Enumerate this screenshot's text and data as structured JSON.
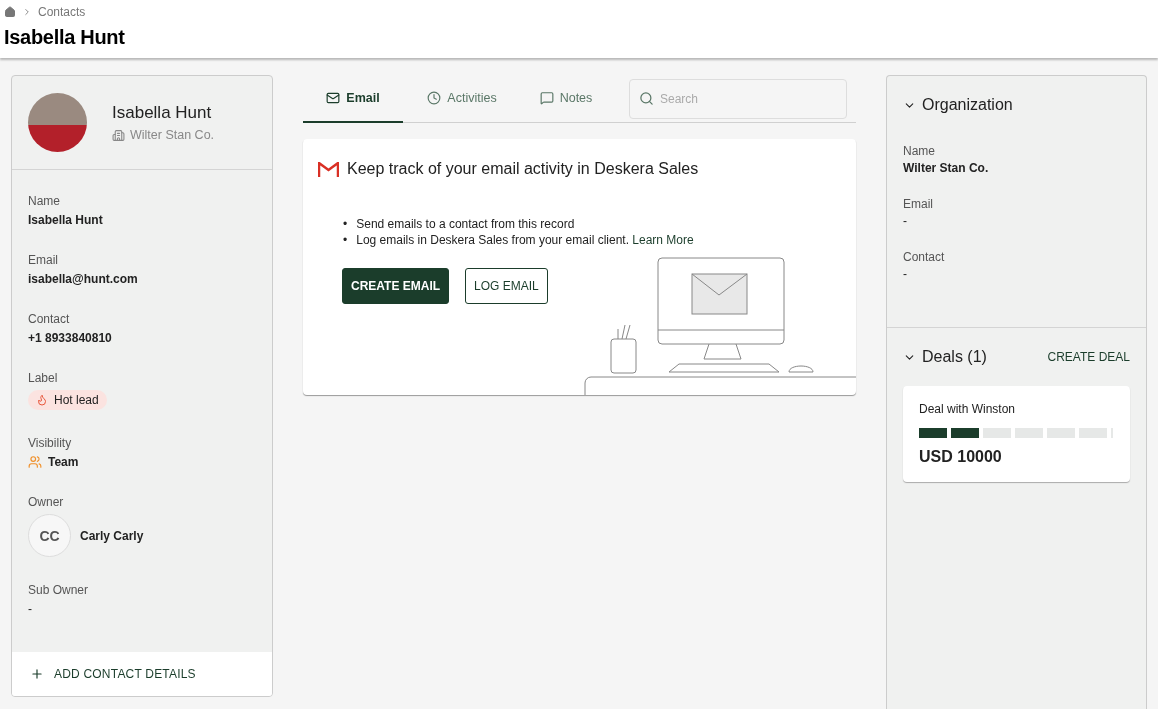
{
  "breadcrumb": {
    "items": [
      "Contacts"
    ]
  },
  "page_title": "Isabella Hunt",
  "profile": {
    "name": "Isabella Hunt",
    "company": "Wilter Stan Co.",
    "fields": [
      {
        "kind": "text",
        "label": "Name",
        "value": "Isabella Hunt"
      },
      {
        "kind": "text",
        "label": "Email",
        "value": "isabella@hunt.com"
      },
      {
        "kind": "text",
        "label": "Contact",
        "value": "+1 8933840810"
      },
      {
        "kind": "tag",
        "label": "Label",
        "value": "Hot lead"
      },
      {
        "kind": "team",
        "label": "Visibility",
        "value": "Team"
      },
      {
        "kind": "owner",
        "label": "Owner",
        "initials": "CC",
        "value": "Carly Carly"
      },
      {
        "kind": "plain",
        "label": "Sub Owner",
        "value": "-"
      }
    ],
    "add_button": "ADD CONTACT DETAILS"
  },
  "tabs": [
    {
      "label": "Email",
      "selected": true
    },
    {
      "label": "Activities",
      "selected": false
    },
    {
      "label": "Notes",
      "selected": false
    }
  ],
  "search": {
    "placeholder": "Search"
  },
  "email_panel": {
    "title": "Keep track of your email activity in Deskera Sales",
    "bullets": [
      {
        "marker": "•",
        "text": "Send emails to a contact from this record"
      },
      {
        "marker": "•",
        "text": "Log emails in Deskera Sales from your email client.",
        "link": "Learn More"
      }
    ],
    "buttons": [
      {
        "label": "CREATE EMAIL",
        "kind": "primary"
      },
      {
        "label": "LOG EMAIL",
        "kind": "outline"
      }
    ]
  },
  "organization": {
    "title": "Organization",
    "expanded": true,
    "fields": [
      {
        "label": "Name",
        "value": "Wilter Stan Co."
      },
      {
        "label": "Email",
        "value": "-"
      },
      {
        "label": "Contact",
        "value": "-"
      }
    ]
  },
  "deals": {
    "title": "Deals (1)",
    "expanded": true,
    "action": "CREATE DEAL",
    "items": [
      {
        "name": "Deal with Winston",
        "amount": "USD 10000",
        "stages": [
          {
            "completed": true
          },
          {
            "completed": true
          },
          {
            "completed": false
          },
          {
            "completed": false
          },
          {
            "completed": false
          },
          {
            "completed": false
          },
          {
            "completed": false
          }
        ]
      }
    ]
  }
}
